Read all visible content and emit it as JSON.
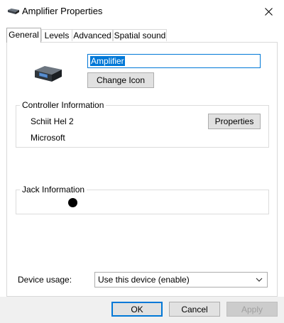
{
  "window": {
    "title": "Amplifier Properties",
    "title_icon": "speaker-device-icon",
    "close_icon": "close-icon"
  },
  "tabs": [
    {
      "label": "General",
      "active": true
    },
    {
      "label": "Levels",
      "active": false
    },
    {
      "label": "Advanced",
      "active": false
    },
    {
      "label": "Spatial sound",
      "active": false
    }
  ],
  "general": {
    "device_icon": "audio-device-icon",
    "name_value": "Amplifier",
    "change_icon_label": "Change Icon",
    "controller": {
      "title": "Controller Information",
      "name": "Schiit Hel 2",
      "manufacturer": "Microsoft",
      "properties_label": "Properties"
    },
    "jack": {
      "title": "Jack Information",
      "color": "#000000"
    },
    "device_usage": {
      "label": "Device usage:",
      "selected": "Use this device (enable)"
    }
  },
  "footer": {
    "ok_label": "OK",
    "cancel_label": "Cancel",
    "apply_label": "Apply"
  }
}
